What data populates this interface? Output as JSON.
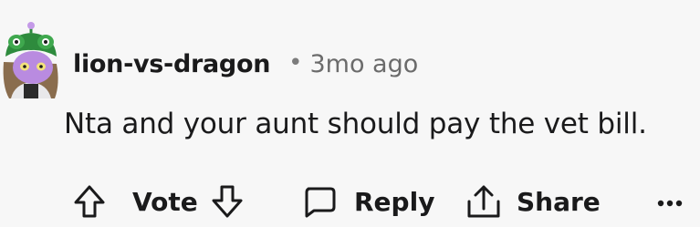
{
  "comment": {
    "username": "lion-vs-dragon",
    "separator": "•",
    "timestamp": "3mo ago",
    "text": "Nta and your aunt should pay the vet bill.",
    "avatar_icon": "frog-hat-snoo-avatar"
  },
  "actions": {
    "upvote_icon": "arrow-up-icon",
    "vote_label": "Vote",
    "downvote_icon": "arrow-down-icon",
    "reply_icon": "speech-bubble-icon",
    "reply_label": "Reply",
    "share_icon": "share-icon",
    "share_label": "Share",
    "more_icon": "ellipsis-icon"
  },
  "colors": {
    "background": "#f7f7f7",
    "text": "#1a1a1b",
    "meta": "#6b6b6b",
    "avatar_hat": "#2e8b3d",
    "avatar_face": "#b98be0"
  }
}
